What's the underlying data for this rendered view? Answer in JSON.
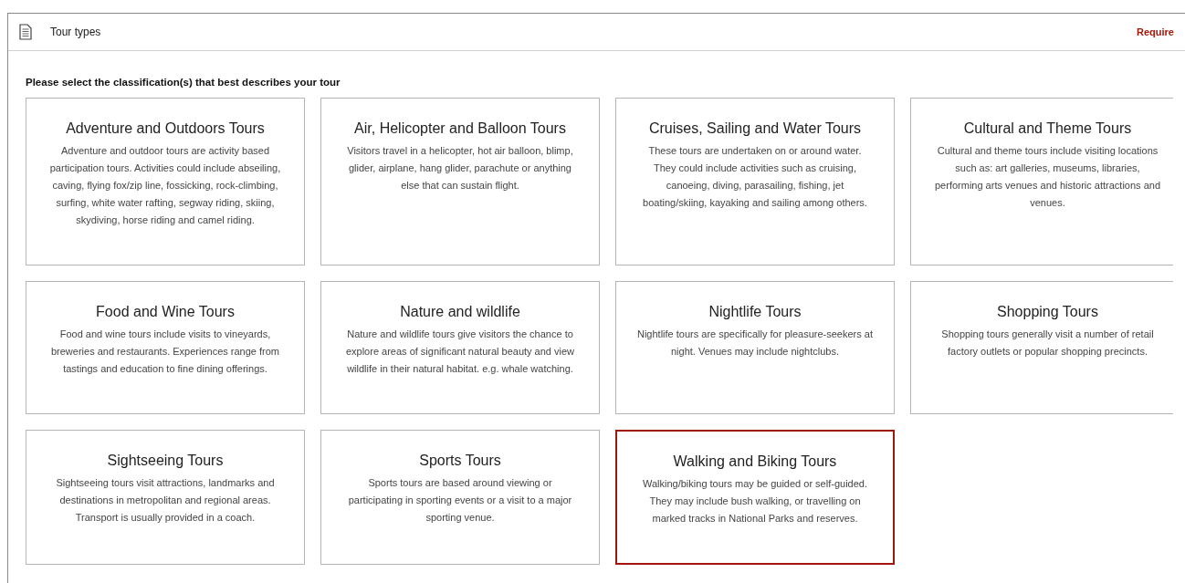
{
  "panel": {
    "title": "Tour types",
    "required_label": "Require"
  },
  "instruction": "Please select the classification(s) that best describes your tour",
  "tour_types": [
    {
      "title": "Adventure and Outdoors Tours",
      "description": "Adventure and outdoor tours are activity based participation tours. Activities could include abseiling, caving, flying fox/zip line, fossicking, rock-climbing, surfing, white water rafting, segway riding, skiing, skydiving, horse riding and camel riding.",
      "selected": false
    },
    {
      "title": "Air, Helicopter and Balloon Tours",
      "description": "Visitors travel in a helicopter, hot air balloon, blimp, glider, airplane, hang glider, parachute or anything else that can sustain flight.",
      "selected": false
    },
    {
      "title": "Cruises, Sailing and Water Tours",
      "description": "These tours are undertaken on or around water. They could include activities such as cruising, canoeing, diving, parasailing, fishing, jet boating/skiing, kayaking and sailing among others.",
      "selected": false
    },
    {
      "title": "Cultural and Theme Tours",
      "description": "Cultural and theme tours include visiting locations such as: art galleries, museums, libraries, performing arts venues and historic attractions and venues.",
      "selected": false
    },
    {
      "title": "Food and Wine Tours",
      "description": "Food and wine tours include visits to vineyards, breweries and restaurants. Experiences range from tastings and education to fine dining offerings.",
      "selected": false
    },
    {
      "title": "Nature and wildlife",
      "description": "Nature and wildlife tours give visitors the chance to explore areas of significant natural beauty and view wildlife in their natural habitat. e.g. whale watching.",
      "selected": false
    },
    {
      "title": "Nightlife Tours",
      "description": "Nightlife tours are specifically for pleasure-seekers at night. Venues may include nightclubs.",
      "selected": false
    },
    {
      "title": "Shopping Tours",
      "description": "Shopping tours generally visit a number of retail factory outlets or popular shopping precincts.",
      "selected": false
    },
    {
      "title": "Sightseeing Tours",
      "description": "Sightseeing tours visit attractions, landmarks and destinations in metropolitan and regional areas. Transport is usually provided in a coach.",
      "selected": false
    },
    {
      "title": "Sports Tours",
      "description": "Sports tours are based around viewing or participating in sporting events or a visit to a major sporting venue.",
      "selected": false
    },
    {
      "title": "Walking and Biking Tours",
      "description": "Walking/biking tours may be guided or self-guided. They may include bush walking, or travelling on marked tracks in National Parks and reserves.",
      "selected": true
    }
  ]
}
